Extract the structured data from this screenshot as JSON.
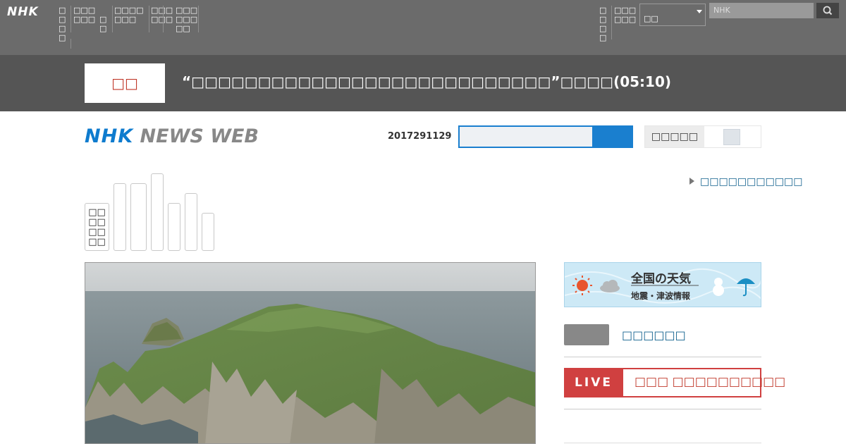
{
  "global_header": {
    "logo": "NHK",
    "nav_items": [
      "□□□□",
      "□□□□□□",
      "□□",
      "□□□□□□□",
      "□□□□□□",
      "□□□□□□□□",
      "□□□□",
      "□□□□□□"
    ],
    "area_select_value": "□□",
    "search_placeholder": "NHK"
  },
  "breaking": {
    "tag": "□□",
    "headline": "“□□□□□□□□□□□□□□□□□□□□□□□□□□□”□□□□(05:10)"
  },
  "site_header": {
    "logo_part1": "NHK",
    "logo_part2": "NEWS WEB",
    "date": "2017291129",
    "font_size_label": "□□□□□"
  },
  "categories": [
    "□□□□□□□□",
    "",
    "",
    "",
    "",
    "",
    ""
  ],
  "more_link": "□□□□□□□□□□□",
  "right_column": {
    "weather_title": "全国の天気",
    "weather_subtitle": "地震・津波情報",
    "link_text": "□□□□□□",
    "live_label": "LIVE",
    "live_text": "□□□ □□□□□□□□□□"
  },
  "colors": {
    "topbar": "#6b6b6b",
    "breaking_band": "#555555",
    "brand_blue": "#0e7bce",
    "live_red": "#d04040"
  }
}
